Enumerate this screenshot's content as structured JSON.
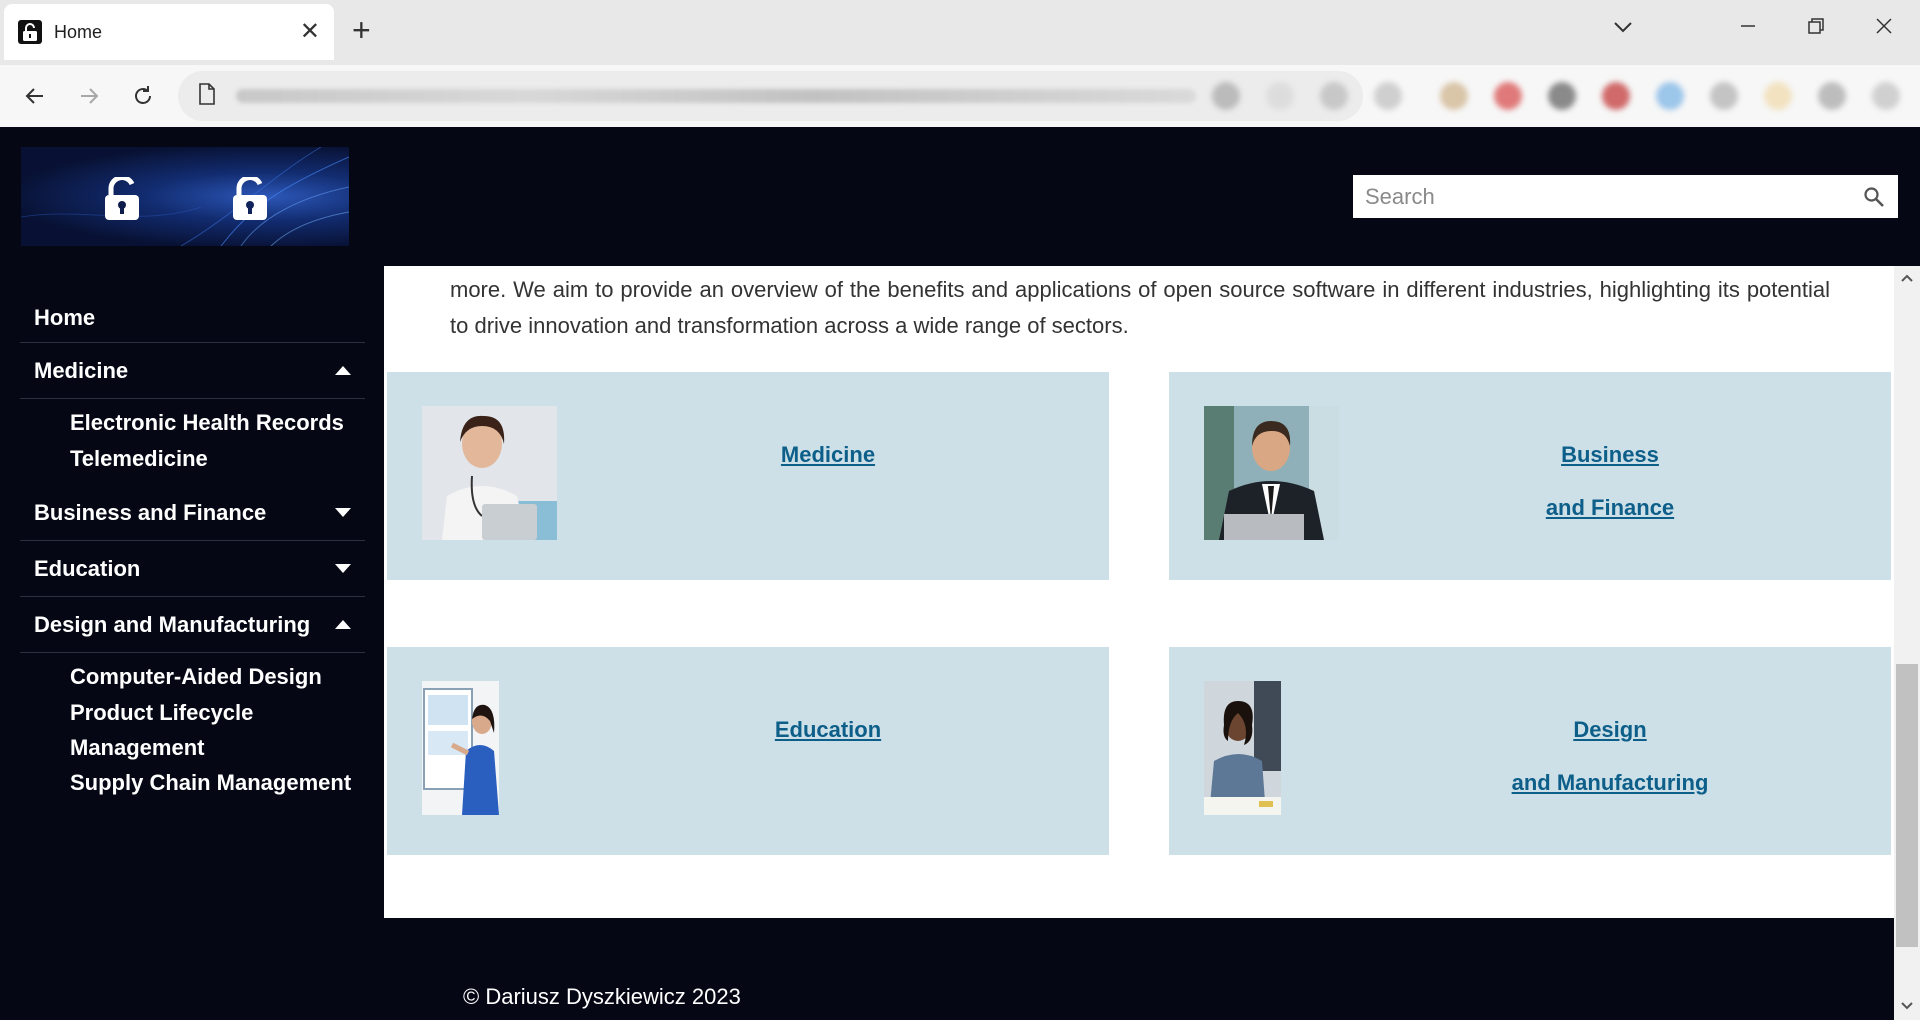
{
  "browser": {
    "tab_title": "Home",
    "icons": [
      "lock-favicon-icon",
      "close-icon",
      "plus-icon",
      "chevron-down-icon",
      "minimize-icon",
      "restore-icon",
      "window-close-icon",
      "back-arrow-icon",
      "forward-arrow-icon",
      "reload-icon",
      "page-icon"
    ]
  },
  "search": {
    "placeholder": "Search"
  },
  "sidebar": {
    "home": "Home",
    "sections": [
      {
        "label": "Medicine",
        "expanded": true,
        "items": [
          "Electronic Health Records",
          "Telemedicine"
        ]
      },
      {
        "label": "Business and Finance",
        "expanded": false,
        "items": []
      },
      {
        "label": "Education",
        "expanded": false,
        "items": []
      },
      {
        "label": "Design and Manufacturing",
        "expanded": true,
        "items": [
          "Computer-Aided Design",
          "Product Lifecycle Management",
          "Supply Chain Management"
        ]
      }
    ]
  },
  "main": {
    "intro": "more. We aim to provide an overview of the benefits and applications of open source software in different industries, highlighting its potential to drive innovation and transformation across a wide range of sectors.",
    "cards": [
      {
        "line1": "Medicine",
        "line2": ""
      },
      {
        "line1": "Business",
        "line2": "and Finance"
      },
      {
        "line1": "Education",
        "line2": ""
      },
      {
        "line1": "Design",
        "line2": "and Manufacturing"
      }
    ]
  },
  "footer": {
    "text": "© Dariusz Dyszkiewicz 2023"
  },
  "colors": {
    "page_bg": "#050814",
    "card_bg": "#cde0e8",
    "link": "#0d5f8a",
    "content_bg": "#ffffff"
  }
}
